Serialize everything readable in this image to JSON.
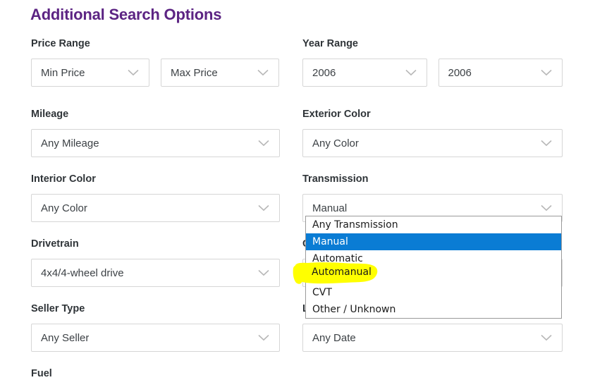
{
  "page": {
    "title": "Additional Search Options",
    "title_color": "#5c2483"
  },
  "left_column": [
    {
      "label": "Price Range",
      "dual": true,
      "fields": [
        {
          "name": "min-price",
          "value": "Min Price"
        },
        {
          "name": "max-price",
          "value": "Max Price"
        }
      ]
    },
    {
      "label": "Mileage",
      "dual": false,
      "fields": [
        {
          "name": "mileage",
          "value": "Any Mileage"
        }
      ]
    },
    {
      "label": "Interior Color",
      "dual": false,
      "fields": [
        {
          "name": "interior-color",
          "value": "Any Color"
        }
      ]
    },
    {
      "label": "Drivetrain",
      "dual": false,
      "fields": [
        {
          "name": "drivetrain",
          "value": "4x4/4-wheel drive"
        }
      ]
    },
    {
      "label": "Seller Type",
      "dual": false,
      "fields": [
        {
          "name": "seller-type",
          "value": "Any Seller"
        }
      ]
    },
    {
      "label": "Fuel",
      "dual": false,
      "fields": []
    }
  ],
  "right_column": [
    {
      "label": "Year Range",
      "dual": true,
      "fields": [
        {
          "name": "year-min",
          "value": "2006"
        },
        {
          "name": "year-max",
          "value": "2006"
        }
      ]
    },
    {
      "label": "Exterior Color",
      "dual": false,
      "fields": [
        {
          "name": "exterior-color",
          "value": "Any Color"
        }
      ]
    },
    {
      "label": "Transmission",
      "dual": false,
      "fields": [
        {
          "name": "transmission",
          "value": "Manual"
        }
      ]
    },
    {
      "label": "C",
      "dual": false,
      "fields": [
        {
          "name": "obscured-select-1",
          "value": ""
        }
      ]
    },
    {
      "label": "L",
      "dual": false,
      "fields": [
        {
          "name": "listing-date",
          "value": "Any Date"
        }
      ]
    }
  ],
  "transmission_dropdown": {
    "open": true,
    "selected_index": 1,
    "highlight_color": "#0a7cd4",
    "marker_color": "#ffff00",
    "annotated_option": "Automanual",
    "options": [
      "Any Transmission",
      "Manual",
      "Automatic",
      "Automanual",
      "CVT",
      "Other / Unknown"
    ]
  }
}
